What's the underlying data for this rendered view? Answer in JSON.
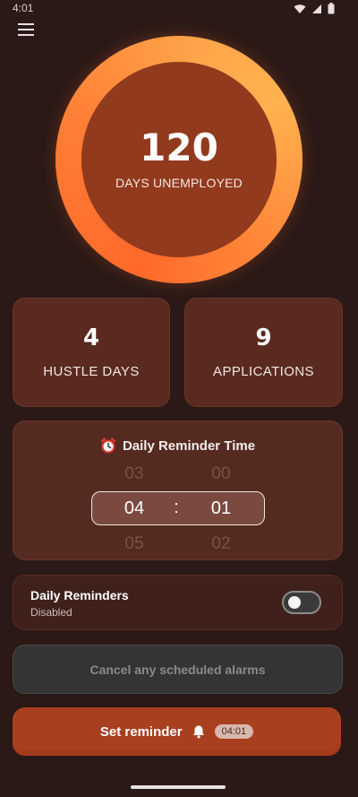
{
  "status_bar": {
    "time": "4:01",
    "icons": [
      "wifi-icon",
      "signal-icon",
      "battery-icon"
    ]
  },
  "counter": {
    "value": "120",
    "label": "DAYS UNEMPLOYED"
  },
  "stats": [
    {
      "value": "4",
      "label": "HUSTLE DAYS"
    },
    {
      "value": "9",
      "label": "APPLICATIONS"
    }
  ],
  "reminder": {
    "title": "Daily Reminder Time",
    "icon": "alarm-clock-icon",
    "hours": {
      "prev": "03",
      "selected": "04",
      "next": "05"
    },
    "minutes": {
      "prev": "00",
      "selected": "01",
      "next": "02"
    },
    "separator": ":"
  },
  "daily_reminders": {
    "title": "Daily Reminders",
    "status": "Disabled",
    "enabled": false
  },
  "buttons": {
    "cancel_label": "Cancel any scheduled alarms",
    "set_label": "Set reminder",
    "set_time_badge": "04:01"
  },
  "colors": {
    "background": "#2a1916",
    "accent": "#a8401f",
    "ring_start": "#ff6a2a",
    "ring_end": "#ffb24f"
  }
}
